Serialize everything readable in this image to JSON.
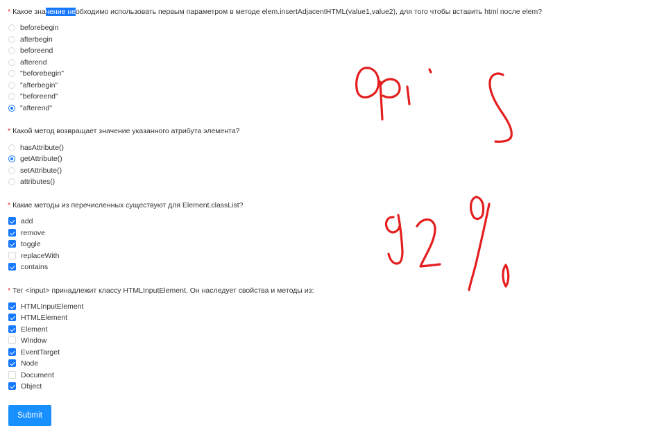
{
  "questions": [
    {
      "required_mark": "*",
      "text_before": "Какое зна",
      "text_highlight": "чение не",
      "text_after": "обходимо использовать первым параметром в методе elem.insertAdjacentHTML(value1,value2), для того чтобы вставить html после elem?",
      "type": "radio",
      "options": [
        {
          "label": "beforebegin",
          "checked": false
        },
        {
          "label": "afterbegin",
          "checked": false
        },
        {
          "label": "beforeend",
          "checked": false
        },
        {
          "label": "afterend",
          "checked": false
        },
        {
          "label": "\"beforebegin\"",
          "checked": false
        },
        {
          "label": "\"afterbegin\"",
          "checked": false
        },
        {
          "label": "\"beforeend\"",
          "checked": false
        },
        {
          "label": "\"afterend\"",
          "checked": true
        }
      ]
    },
    {
      "required_mark": "*",
      "text": "Какой метод возвращает значение указанного атрибута элемента?",
      "type": "radio",
      "options": [
        {
          "label": "hasAttribute()",
          "checked": false
        },
        {
          "label": "getAttribute()",
          "checked": true
        },
        {
          "label": "setAttribute()",
          "checked": false
        },
        {
          "label": "attributes()",
          "checked": false
        }
      ]
    },
    {
      "required_mark": "*",
      "text": "Какие методы из перечисленных существуют для Element.classList?",
      "type": "checkbox",
      "options": [
        {
          "label": "add",
          "checked": true
        },
        {
          "label": "remove",
          "checked": true
        },
        {
          "label": "toggle",
          "checked": true
        },
        {
          "label": "replaceWith",
          "checked": false
        },
        {
          "label": "contains",
          "checked": true
        }
      ]
    },
    {
      "required_mark": "*",
      "text": "Тег <input> принадлежит классу HTMLInputElement. Он наследует свойства и методы из:",
      "type": "checkbox",
      "options": [
        {
          "label": "HTMLInputElement",
          "checked": true
        },
        {
          "label": "HTMLElement",
          "checked": true
        },
        {
          "label": "Element",
          "checked": true
        },
        {
          "label": "Window",
          "checked": false
        },
        {
          "label": "EventTarget",
          "checked": true
        },
        {
          "label": "Node",
          "checked": true
        },
        {
          "label": "Document",
          "checked": false
        },
        {
          "label": "Object",
          "checked": true
        }
      ]
    }
  ],
  "submit_label": "Submit",
  "annotation_color": "#e41e1e"
}
